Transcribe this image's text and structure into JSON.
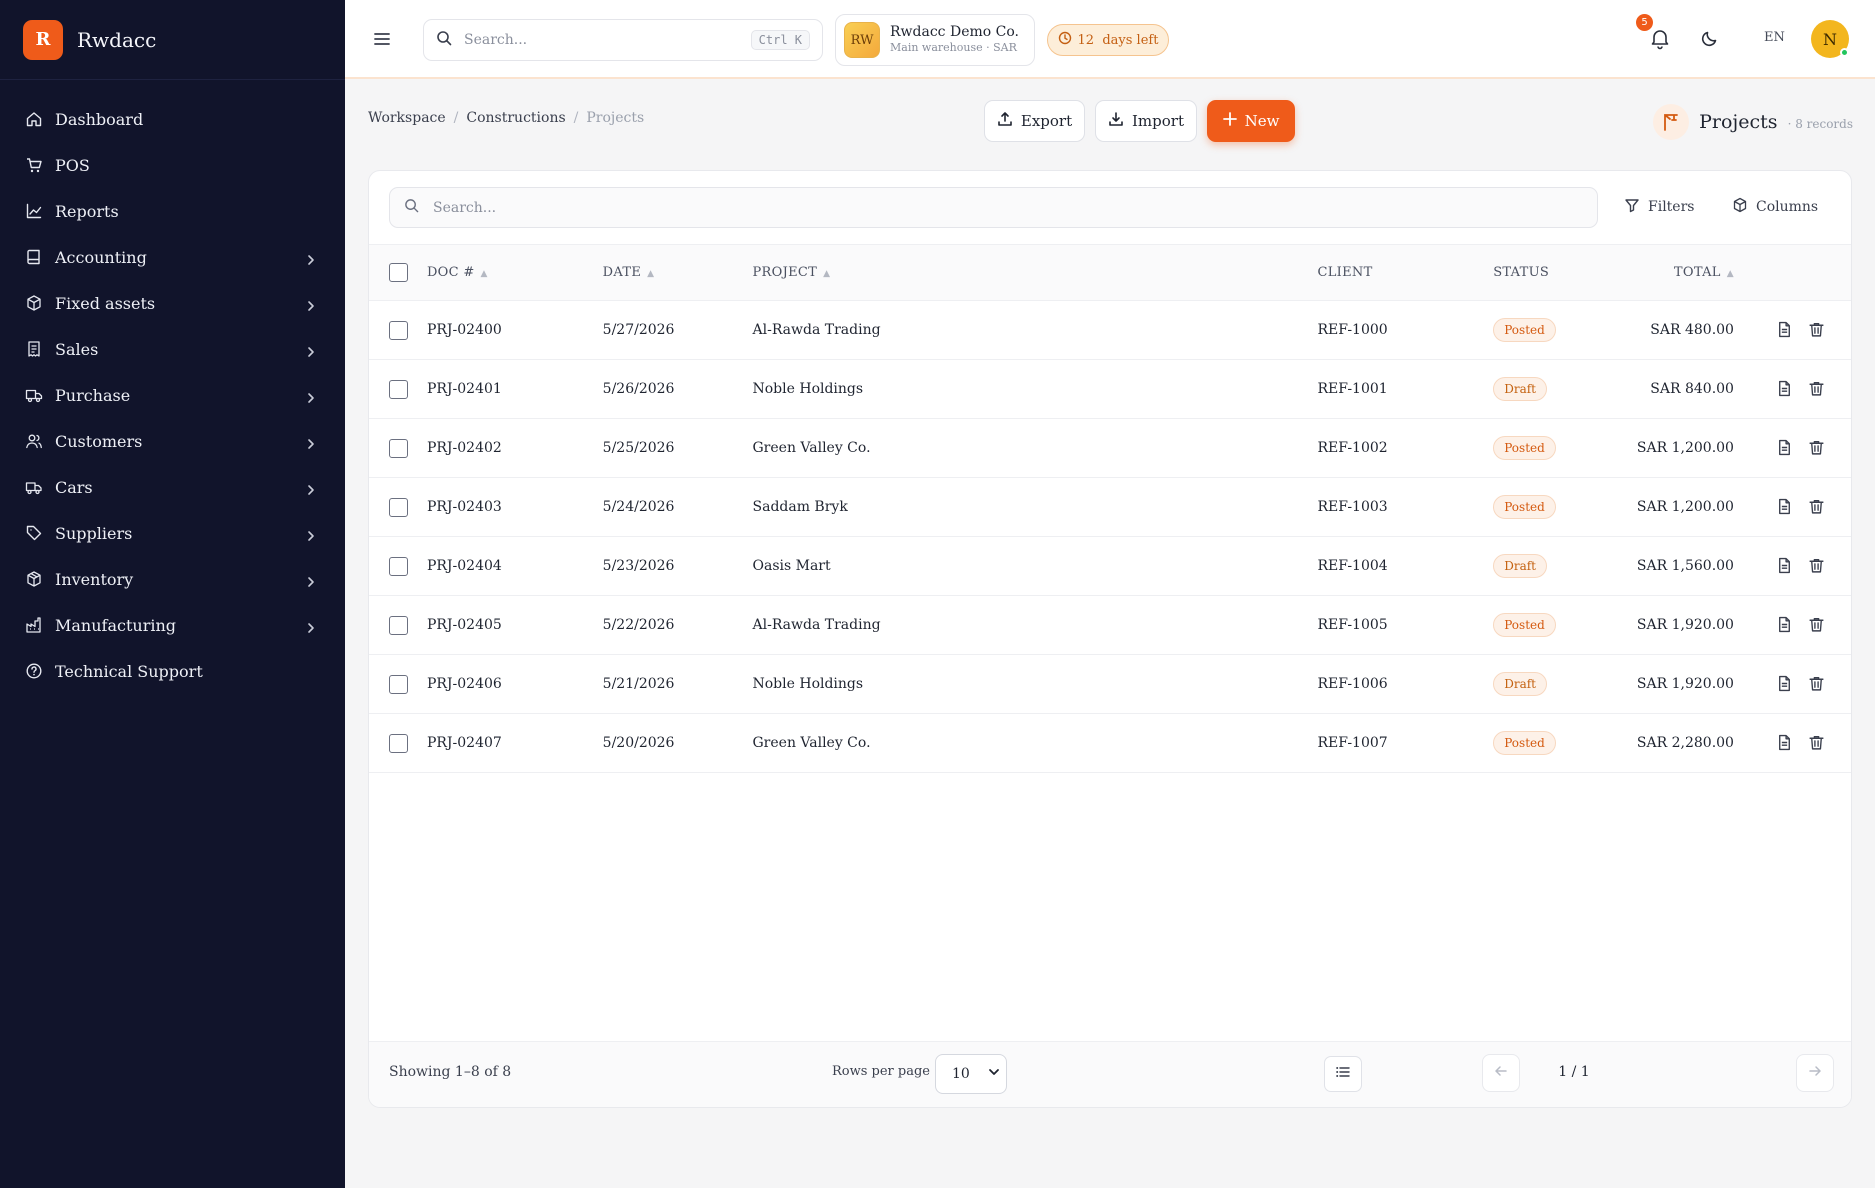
{
  "sidebar": {
    "brand_letter": "R",
    "brand_name": "Rwdacc",
    "items": [
      {
        "label": "Dashboard",
        "icon": "home-icon",
        "chevron": false
      },
      {
        "label": "POS",
        "icon": "cart-icon",
        "chevron": false
      },
      {
        "label": "Reports",
        "icon": "chart-line-icon",
        "chevron": false
      },
      {
        "label": "Accounting",
        "icon": "book-icon",
        "chevron": true
      },
      {
        "label": "Fixed assets",
        "icon": "box-icon",
        "chevron": true
      },
      {
        "label": "Sales",
        "icon": "receipt-icon",
        "chevron": true
      },
      {
        "label": "Purchase",
        "icon": "truck-icon",
        "chevron": true
      },
      {
        "label": "Customers",
        "icon": "users-icon",
        "chevron": true
      },
      {
        "label": "Cars",
        "icon": "car-icon",
        "chevron": true
      },
      {
        "label": "Suppliers",
        "icon": "tag-icon",
        "chevron": true
      },
      {
        "label": "Inventory",
        "icon": "package-icon",
        "chevron": true
      },
      {
        "label": "Manufacturing",
        "icon": "factory-icon",
        "chevron": true
      },
      {
        "label": "Technical Support",
        "icon": "help-circle-icon",
        "chevron": false
      }
    ]
  },
  "topbar": {
    "search_placeholder": "Search...",
    "search_shortcut": "Ctrl K",
    "company_initials": "RW",
    "company_name": "Rwdacc Demo Co.",
    "company_sub": "Main warehouse · SAR",
    "trial": "12  days left",
    "notifications": "5",
    "language": "EN",
    "user_initial": "N"
  },
  "breadcrumb": {
    "a": "Workspace",
    "b": "Constructions",
    "c": "Projects",
    "sep": "/"
  },
  "actions": {
    "export": "Export",
    "import": "Import",
    "new": "New"
  },
  "page": {
    "title": "Projects",
    "count": "· 8 records"
  },
  "table": {
    "search_placeholder": "Search...",
    "filters": "Filters",
    "columns_label": "Columns",
    "headers": {
      "doc": "DOC #",
      "date": "DATE",
      "project": "PROJECT",
      "client": "CLIENT",
      "status": "STATUS",
      "total": "TOTAL"
    },
    "rows": [
      {
        "doc": "PRJ-02400",
        "date": "5/27/2026",
        "project": "Al-Rawda Trading",
        "client": "REF-1000",
        "status": "Posted",
        "total": "SAR 480.00"
      },
      {
        "doc": "PRJ-02401",
        "date": "5/26/2026",
        "project": "Noble Holdings",
        "client": "REF-1001",
        "status": "Draft",
        "total": "SAR 840.00"
      },
      {
        "doc": "PRJ-02402",
        "date": "5/25/2026",
        "project": "Green Valley Co.",
        "client": "REF-1002",
        "status": "Posted",
        "total": "SAR 1,200.00"
      },
      {
        "doc": "PRJ-02403",
        "date": "5/24/2026",
        "project": "Saddam Bryk",
        "client": "REF-1003",
        "status": "Posted",
        "total": "SAR 1,200.00"
      },
      {
        "doc": "PRJ-02404",
        "date": "5/23/2026",
        "project": "Oasis Mart",
        "client": "REF-1004",
        "status": "Draft",
        "total": "SAR 1,560.00"
      },
      {
        "doc": "PRJ-02405",
        "date": "5/22/2026",
        "project": "Al-Rawda Trading",
        "client": "REF-1005",
        "status": "Posted",
        "total": "SAR 1,920.00"
      },
      {
        "doc": "PRJ-02406",
        "date": "5/21/2026",
        "project": "Noble Holdings",
        "client": "REF-1006",
        "status": "Draft",
        "total": "SAR 1,920.00"
      },
      {
        "doc": "PRJ-02407",
        "date": "5/20/2026",
        "project": "Green Valley Co.",
        "client": "REF-1007",
        "status": "Posted",
        "total": "SAR 2,280.00"
      }
    ]
  },
  "footer": {
    "showing": "Showing 1–8 of 8",
    "rows_per_page": "Rows per page",
    "rows_value": "10",
    "page": "1 / 1"
  },
  "colors": {
    "accent": "#ef5b1a",
    "sidebar_bg": "#11142b"
  }
}
